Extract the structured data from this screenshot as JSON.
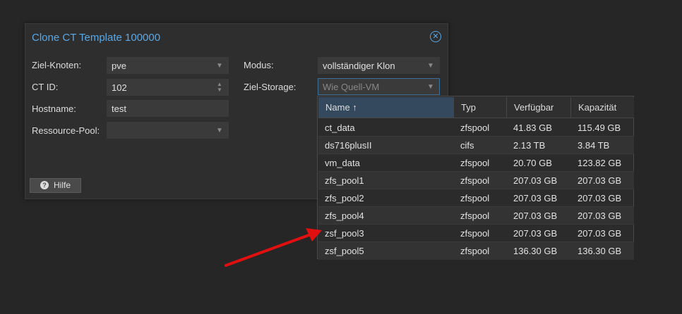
{
  "dialog": {
    "title": "Clone CT Template 100000",
    "close_icon": "close-icon",
    "fields": {
      "ziel_knoten": {
        "label": "Ziel-Knoten:",
        "value": "pve"
      },
      "ct_id": {
        "label": "CT ID:",
        "value": "102"
      },
      "hostname": {
        "label": "Hostname:",
        "value": "test"
      },
      "ressource_pool": {
        "label": "Ressource-Pool:",
        "value": ""
      },
      "modus": {
        "label": "Modus:",
        "value": "vollständiger Klon"
      },
      "ziel_storage": {
        "label": "Ziel-Storage:",
        "value": "Wie Quell-VM"
      }
    },
    "help_button": {
      "label": "Hilfe",
      "icon": "question-circle-icon"
    }
  },
  "storage_dropdown": {
    "columns": [
      "Name ↑",
      "Typ",
      "Verfügbar",
      "Kapazität"
    ],
    "rows": [
      [
        "ct_data",
        "zfspool",
        "41.83 GB",
        "115.49 GB"
      ],
      [
        "ds716plusII",
        "cifs",
        "2.13 TB",
        "3.84 TB"
      ],
      [
        "vm_data",
        "zfspool",
        "20.70 GB",
        "123.82 GB"
      ],
      [
        "zfs_pool1",
        "zfspool",
        "207.03 GB",
        "207.03 GB"
      ],
      [
        "zfs_pool2",
        "zfspool",
        "207.03 GB",
        "207.03 GB"
      ],
      [
        "zfs_pool4",
        "zfspool",
        "207.03 GB",
        "207.03 GB"
      ],
      [
        "zsf_pool3",
        "zfspool",
        "207.03 GB",
        "207.03 GB"
      ],
      [
        "zsf_pool5",
        "zfspool",
        "136.30 GB",
        "136.30 GB"
      ]
    ]
  },
  "colors": {
    "accent": "#5aa8e6",
    "annotation_arrow": "#e01010"
  }
}
